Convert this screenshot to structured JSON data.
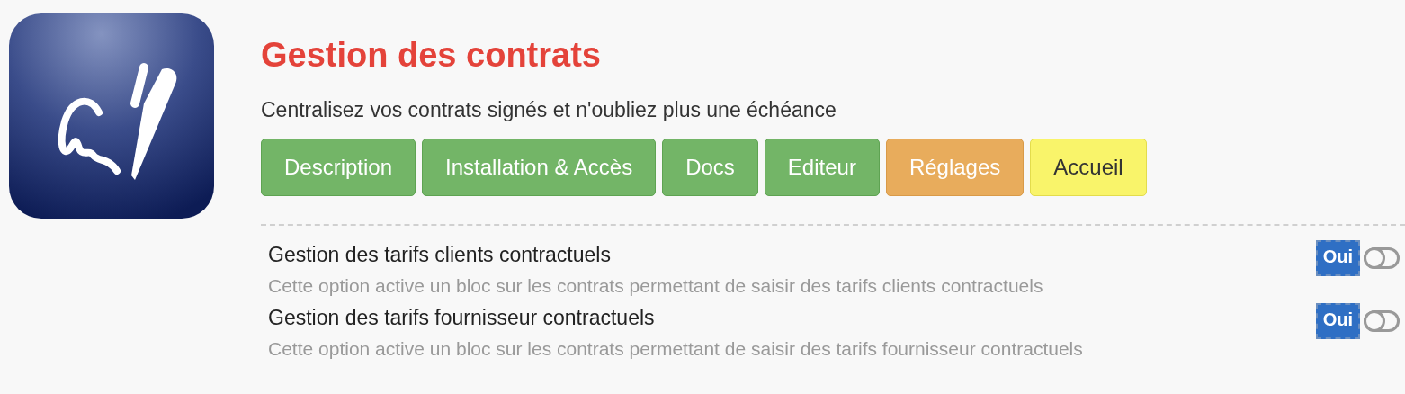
{
  "header": {
    "title": "Gestion des contrats",
    "subtitle": "Centralisez vos contrats signés et n'oubliez plus une échéance"
  },
  "tabs": [
    {
      "label": "Description",
      "kind": "info"
    },
    {
      "label": "Installation & Accès",
      "kind": "info"
    },
    {
      "label": "Docs",
      "kind": "info"
    },
    {
      "label": "Editeur",
      "kind": "info"
    },
    {
      "label": "Réglages",
      "kind": "settings"
    },
    {
      "label": "Accueil",
      "kind": "home"
    }
  ],
  "options": [
    {
      "title": "Gestion des tarifs clients contractuels",
      "description": "Cette option active un bloc sur les contrats permettant de saisir des tarifs clients contractuels",
      "badge": "Oui",
      "on": false
    },
    {
      "title": "Gestion des tarifs fournisseur contractuels",
      "description": "Cette option active un bloc sur les contrats permettant de saisir des tarifs fournisseur contractuels",
      "badge": "Oui",
      "on": false
    }
  ]
}
